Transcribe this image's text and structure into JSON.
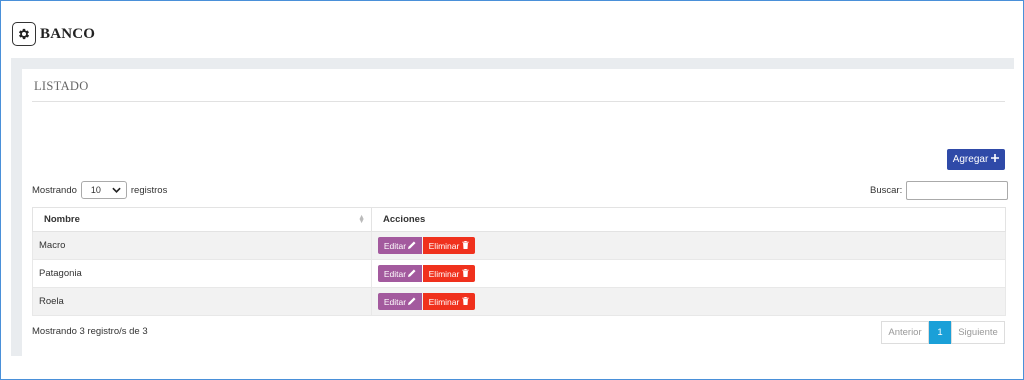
{
  "header": {
    "title": "BANCO",
    "icon": "gear-icon"
  },
  "section": {
    "title": "LISTADO"
  },
  "toolbar": {
    "add_label": "Agregar",
    "add_icon": "plus-icon"
  },
  "length_menu": {
    "prefix": "Mostrando",
    "value": "10",
    "suffix": "registros"
  },
  "search": {
    "label": "Buscar:",
    "value": ""
  },
  "table": {
    "headers": {
      "name": "Nombre",
      "actions": "Acciones"
    },
    "rows": [
      {
        "name": "Macro",
        "edit_label": "Editar",
        "delete_label": "Eliminar"
      },
      {
        "name": "Patagonia",
        "edit_label": "Editar",
        "delete_label": "Eliminar"
      },
      {
        "name": "Roela",
        "edit_label": "Editar",
        "delete_label": "Eliminar"
      }
    ]
  },
  "footer": {
    "info": "Mostrando 3 registro/s de 3"
  },
  "pagination": {
    "previous": "Anterior",
    "current": "1",
    "next": "Siguiente"
  },
  "colors": {
    "add_button": "#2f4aa8",
    "edit_button": "#a35a9e",
    "delete_button": "#f0311d",
    "page_active": "#1aa0d8"
  }
}
